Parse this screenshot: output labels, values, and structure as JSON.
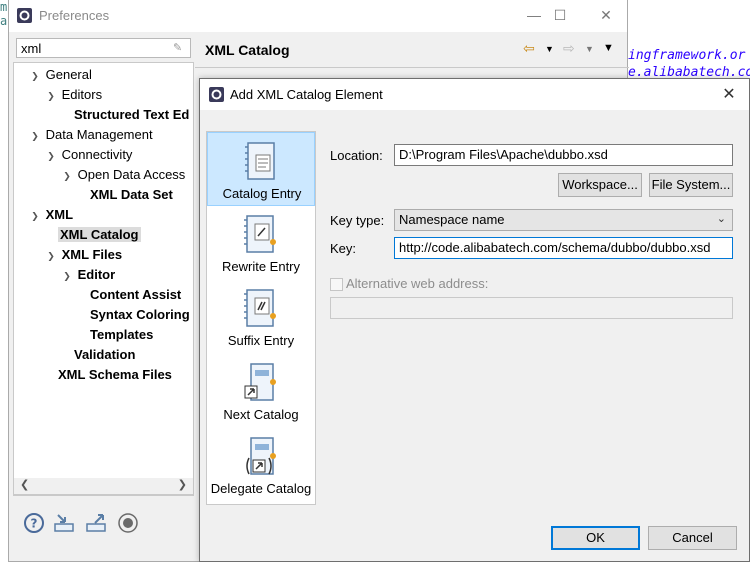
{
  "background": {
    "code_line_1": "ingframework.or",
    "code_line_2": "e.alibabatech.co"
  },
  "preferences": {
    "title": "Preferences",
    "filter_value": "xml",
    "tree": [
      {
        "label": "General",
        "bold": false
      },
      {
        "label": "Editors",
        "bold": false
      },
      {
        "label": "Structured Text Ed",
        "bold": true
      },
      {
        "label": "Data Management",
        "bold": false
      },
      {
        "label": "Connectivity",
        "bold": false
      },
      {
        "label": "Open Data Access",
        "bold": false
      },
      {
        "label": "XML Data Set",
        "bold": true
      },
      {
        "label": "XML",
        "bold": true
      },
      {
        "label": "XML Catalog",
        "bold": true
      },
      {
        "label": "XML Files",
        "bold": true
      },
      {
        "label": "Editor",
        "bold": true
      },
      {
        "label": "Content Assist",
        "bold": true
      },
      {
        "label": "Syntax Coloring",
        "bold": true
      },
      {
        "label": "Templates",
        "bold": true
      },
      {
        "label": "Validation",
        "bold": true
      },
      {
        "label": "XML Schema Files",
        "bold": true
      }
    ],
    "page_title": "XML Catalog",
    "bottom_icons": [
      "help-icon",
      "import-icon",
      "export-icon",
      "record-icon"
    ]
  },
  "dialog": {
    "title": "Add XML Catalog Element",
    "categories": [
      {
        "label": "Catalog Entry"
      },
      {
        "label": "Rewrite Entry"
      },
      {
        "label": "Suffix Entry"
      },
      {
        "label": "Next Catalog"
      },
      {
        "label": "Delegate Catalog"
      }
    ],
    "location_label": "Location:",
    "location_value": "D:\\Program Files\\Apache\\dubbo.xsd",
    "workspace_button": "Workspace...",
    "file_system_button": "File System...",
    "key_type_label": "Key type:",
    "key_type_value": "Namespace name",
    "key_label": "Key:",
    "key_value": "http://code.alibabatech.com/schema/dubbo/dubbo.xsd",
    "alt_web_label": "Alternative web address:",
    "alt_web_value": "",
    "ok_button": "OK",
    "cancel_button": "Cancel"
  },
  "colors": {
    "accent": "#0078d7",
    "selection": "#cce8ff",
    "code_string": "#2a00ff"
  }
}
